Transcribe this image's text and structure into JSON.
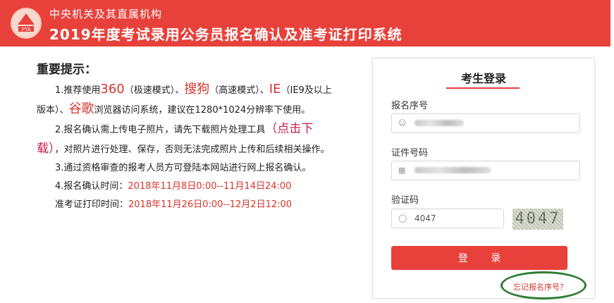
{
  "header": {
    "org": "中央机关及其直属机构",
    "system_title": "2019年度考试录用公务员报名确认及准考证打印系统",
    "logo_text": "PTA"
  },
  "notice": {
    "heading": "重要提示：",
    "item1": {
      "prefix": "1.推荐使用",
      "b360": "360",
      "b360_note": "（极速模式）、",
      "sogou": "搜狗",
      "sogou_note": "（高速模式）、",
      "ie": "IE",
      "ie_note": "（IE9及以上版本）、",
      "google": "谷歌",
      "suffix": "浏览器访问系统，建议在1280*1024分辨率下使用。"
    },
    "item2": {
      "prefix": "2.报名确认需上传电子照片，请先下载照片处理工具",
      "link": "（点击下载）",
      "suffix": "，对照片进行处理、保存，否则无法完成照片上传和后续相关操作。"
    },
    "item3": "3.通过资格审查的报考人员方可登陆本网站进行网上报名确认。",
    "item4_label": "4.报名确认时间：",
    "item4_value": "2018年11月8日0:00--11月14日24:00",
    "item5_label": "准考证打印时间：",
    "item5_value": "2018年11月26日0:00--12月2日12:00"
  },
  "login": {
    "title": "考生登录",
    "reg_label": "报名序号",
    "id_label": "证件号码",
    "captcha_label": "验证码",
    "captcha_value": "4047",
    "captcha_image_text": "4047",
    "submit_label": "登 录",
    "forgot_label": "忘记报名序号？"
  },
  "icons": {
    "user": "user-icon",
    "id_card": "id-card-icon",
    "shield": "shield-icon"
  },
  "colors": {
    "brand_red": "#e8413b",
    "highlight_circle": "#2e7d32"
  }
}
